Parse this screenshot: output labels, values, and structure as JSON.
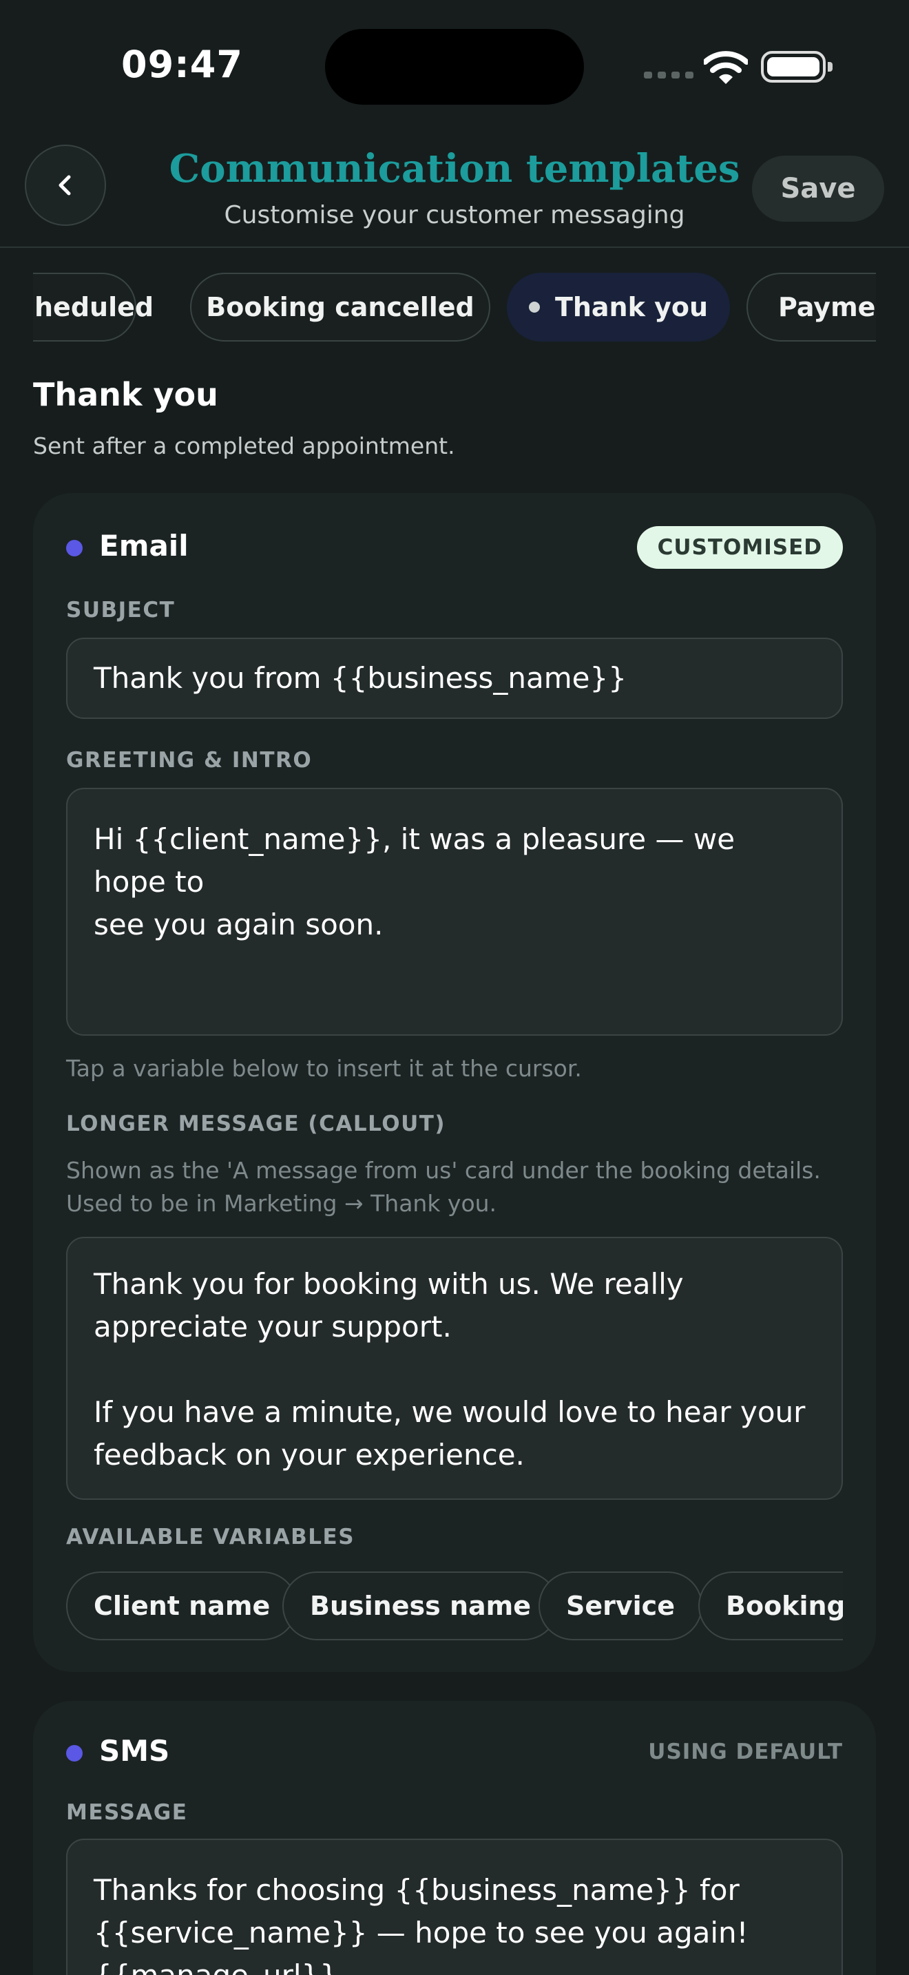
{
  "status_bar": {
    "time": "09:47"
  },
  "header": {
    "title": "Communication templates",
    "subtitle": "Customise your customer messaging",
    "save_label": "Save"
  },
  "tabs": [
    {
      "label": "Scheduled",
      "visible_text": "heduled",
      "active": false
    },
    {
      "label": "Booking cancelled",
      "active": false
    },
    {
      "label": "Thank you",
      "active": true
    },
    {
      "label": "Payment",
      "visible_text": "Paymen",
      "active": false
    }
  ],
  "section": {
    "title": "Thank you",
    "description": "Sent after a completed appointment."
  },
  "email_card": {
    "title": "Email",
    "status_badge": "CUSTOMISED",
    "subject_label": "SUBJECT",
    "subject_value": "Thank you from {{business_name}}",
    "greeting_label": "GREETING & INTRO",
    "greeting_value": "Hi {{client_name}}, it was a pleasure — we hope to\nsee you again soon.",
    "greeting_hint": "Tap a variable below to insert it at the cursor.",
    "callout_label": "LONGER MESSAGE (CALLOUT)",
    "callout_help": "Shown as the 'A message from us' card under the booking details.\nUsed to be in Marketing → Thank you.",
    "callout_value": "Thank you for booking with us. We really\nappreciate your support.\n\nIf you have a minute, we would love to hear your\nfeedback on your experience.",
    "variables_label": "AVAILABLE VARIABLES",
    "variables": [
      "Client name",
      "Business name",
      "Service",
      "Booking date"
    ]
  },
  "sms_card": {
    "title": "SMS",
    "status_badge": "USING DEFAULT",
    "message_label": "MESSAGE",
    "message_value": "Thanks for choosing {{business_name}} for\n{{service_name}} — hope to see you again!\n{{manage_url}}"
  },
  "colors": {
    "background": "#171d1d",
    "card": "#1c2323",
    "title_teal": "#1c9c9c",
    "channel_dot": "#5a58e4",
    "active_tab": "#19223a",
    "badge_bg": "#e3f7e8"
  },
  "icons": [
    "chevron-left-icon",
    "wifi-icon",
    "battery-icon",
    "cellular-signal-icon"
  ]
}
